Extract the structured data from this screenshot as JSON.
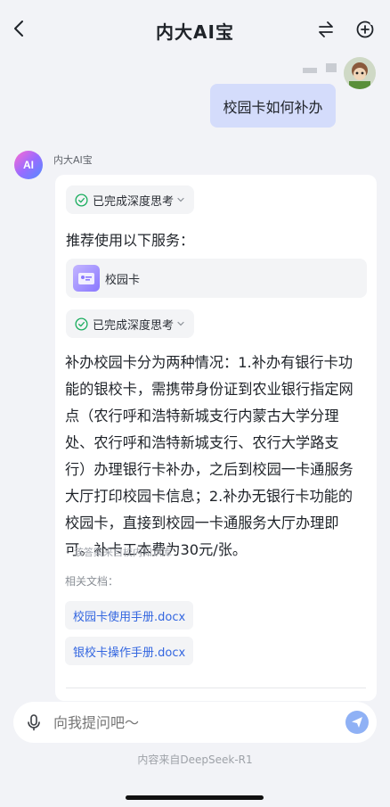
{
  "header": {
    "title": "内大AI宝",
    "back_icon": "chevron-left-icon",
    "swap_icon": "swap-icon",
    "new_chat_icon": "add-circle-icon"
  },
  "user_message": {
    "text": "校园卡如何补办"
  },
  "bot": {
    "avatar_text": "AI",
    "name": "内大AI宝",
    "thinking_label_1": "已完成深度思考",
    "recommend_text": "推荐使用以下服务：",
    "service_label": "校园卡",
    "thinking_label_2": "已完成深度思考",
    "answer_lines": [
      "补办校园卡分为两种情况：1.补办有银行卡功",
      "能的银校卡，需携带身份证到农业银行指定网",
      "点（农行呼和浩特新城支行内蒙古大学分理",
      "处、农行呼和浩特新城支行、农行大学路支",
      "行）办理银行卡补办，之后到校园一卡通服务",
      "大厅打印校园卡信息；2.补办无银行卡功能的",
      "校园卡，直接到校园一卡通服务大厅办理即",
      "可。补卡工本费为30元/张。"
    ],
    "kb_note": "◦ 该答案来自校内知识库",
    "docs_label": "相关文档：",
    "docs": [
      "校园卡使用手册.docx",
      "银校卡操作手册.docx"
    ]
  },
  "input": {
    "placeholder": "向我提问吧～",
    "mic_icon": "microphone-icon",
    "send_icon": "send-icon"
  },
  "footer": {
    "source_text": "内容来自DeepSeek-R1"
  },
  "colors": {
    "background": "#f2f3f7",
    "user_bubble": "#d4dcfb",
    "link": "#3366e0",
    "check_green": "#1aad5e",
    "send_button": "#8fb1f5"
  }
}
